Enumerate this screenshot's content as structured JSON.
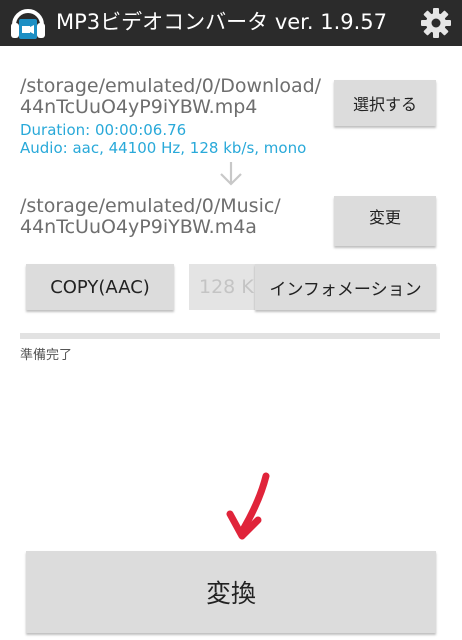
{
  "app": {
    "title": "MP3ビデオコンバータ ver. 1.9.57",
    "icon": "headphones-video-icon",
    "accent": "#29a9d9"
  },
  "source": {
    "path_line1": "/storage/emulated/0/Download/",
    "path_line2": "44nTcUuO4yP9iYBW.mp4",
    "duration": "Duration: 00:00:06.76",
    "audio": "Audio: aac, 44100 Hz, 128 kb/s, mono",
    "select_label": "選択する"
  },
  "output": {
    "path_line1": "/storage/emulated/0/Music/",
    "path_line2": "44nTcUuO4yP9iYBW.m4a",
    "change_label": "変更"
  },
  "options": {
    "codec_label": "COPY(AAC)",
    "bitrate_value": "128 K",
    "information_label": "インフォメーション"
  },
  "progress": {
    "fraction": 0.0
  },
  "status": {
    "text": "準備完了"
  },
  "convert": {
    "label": "変換"
  },
  "annotation": {
    "color": "#e0243a"
  }
}
